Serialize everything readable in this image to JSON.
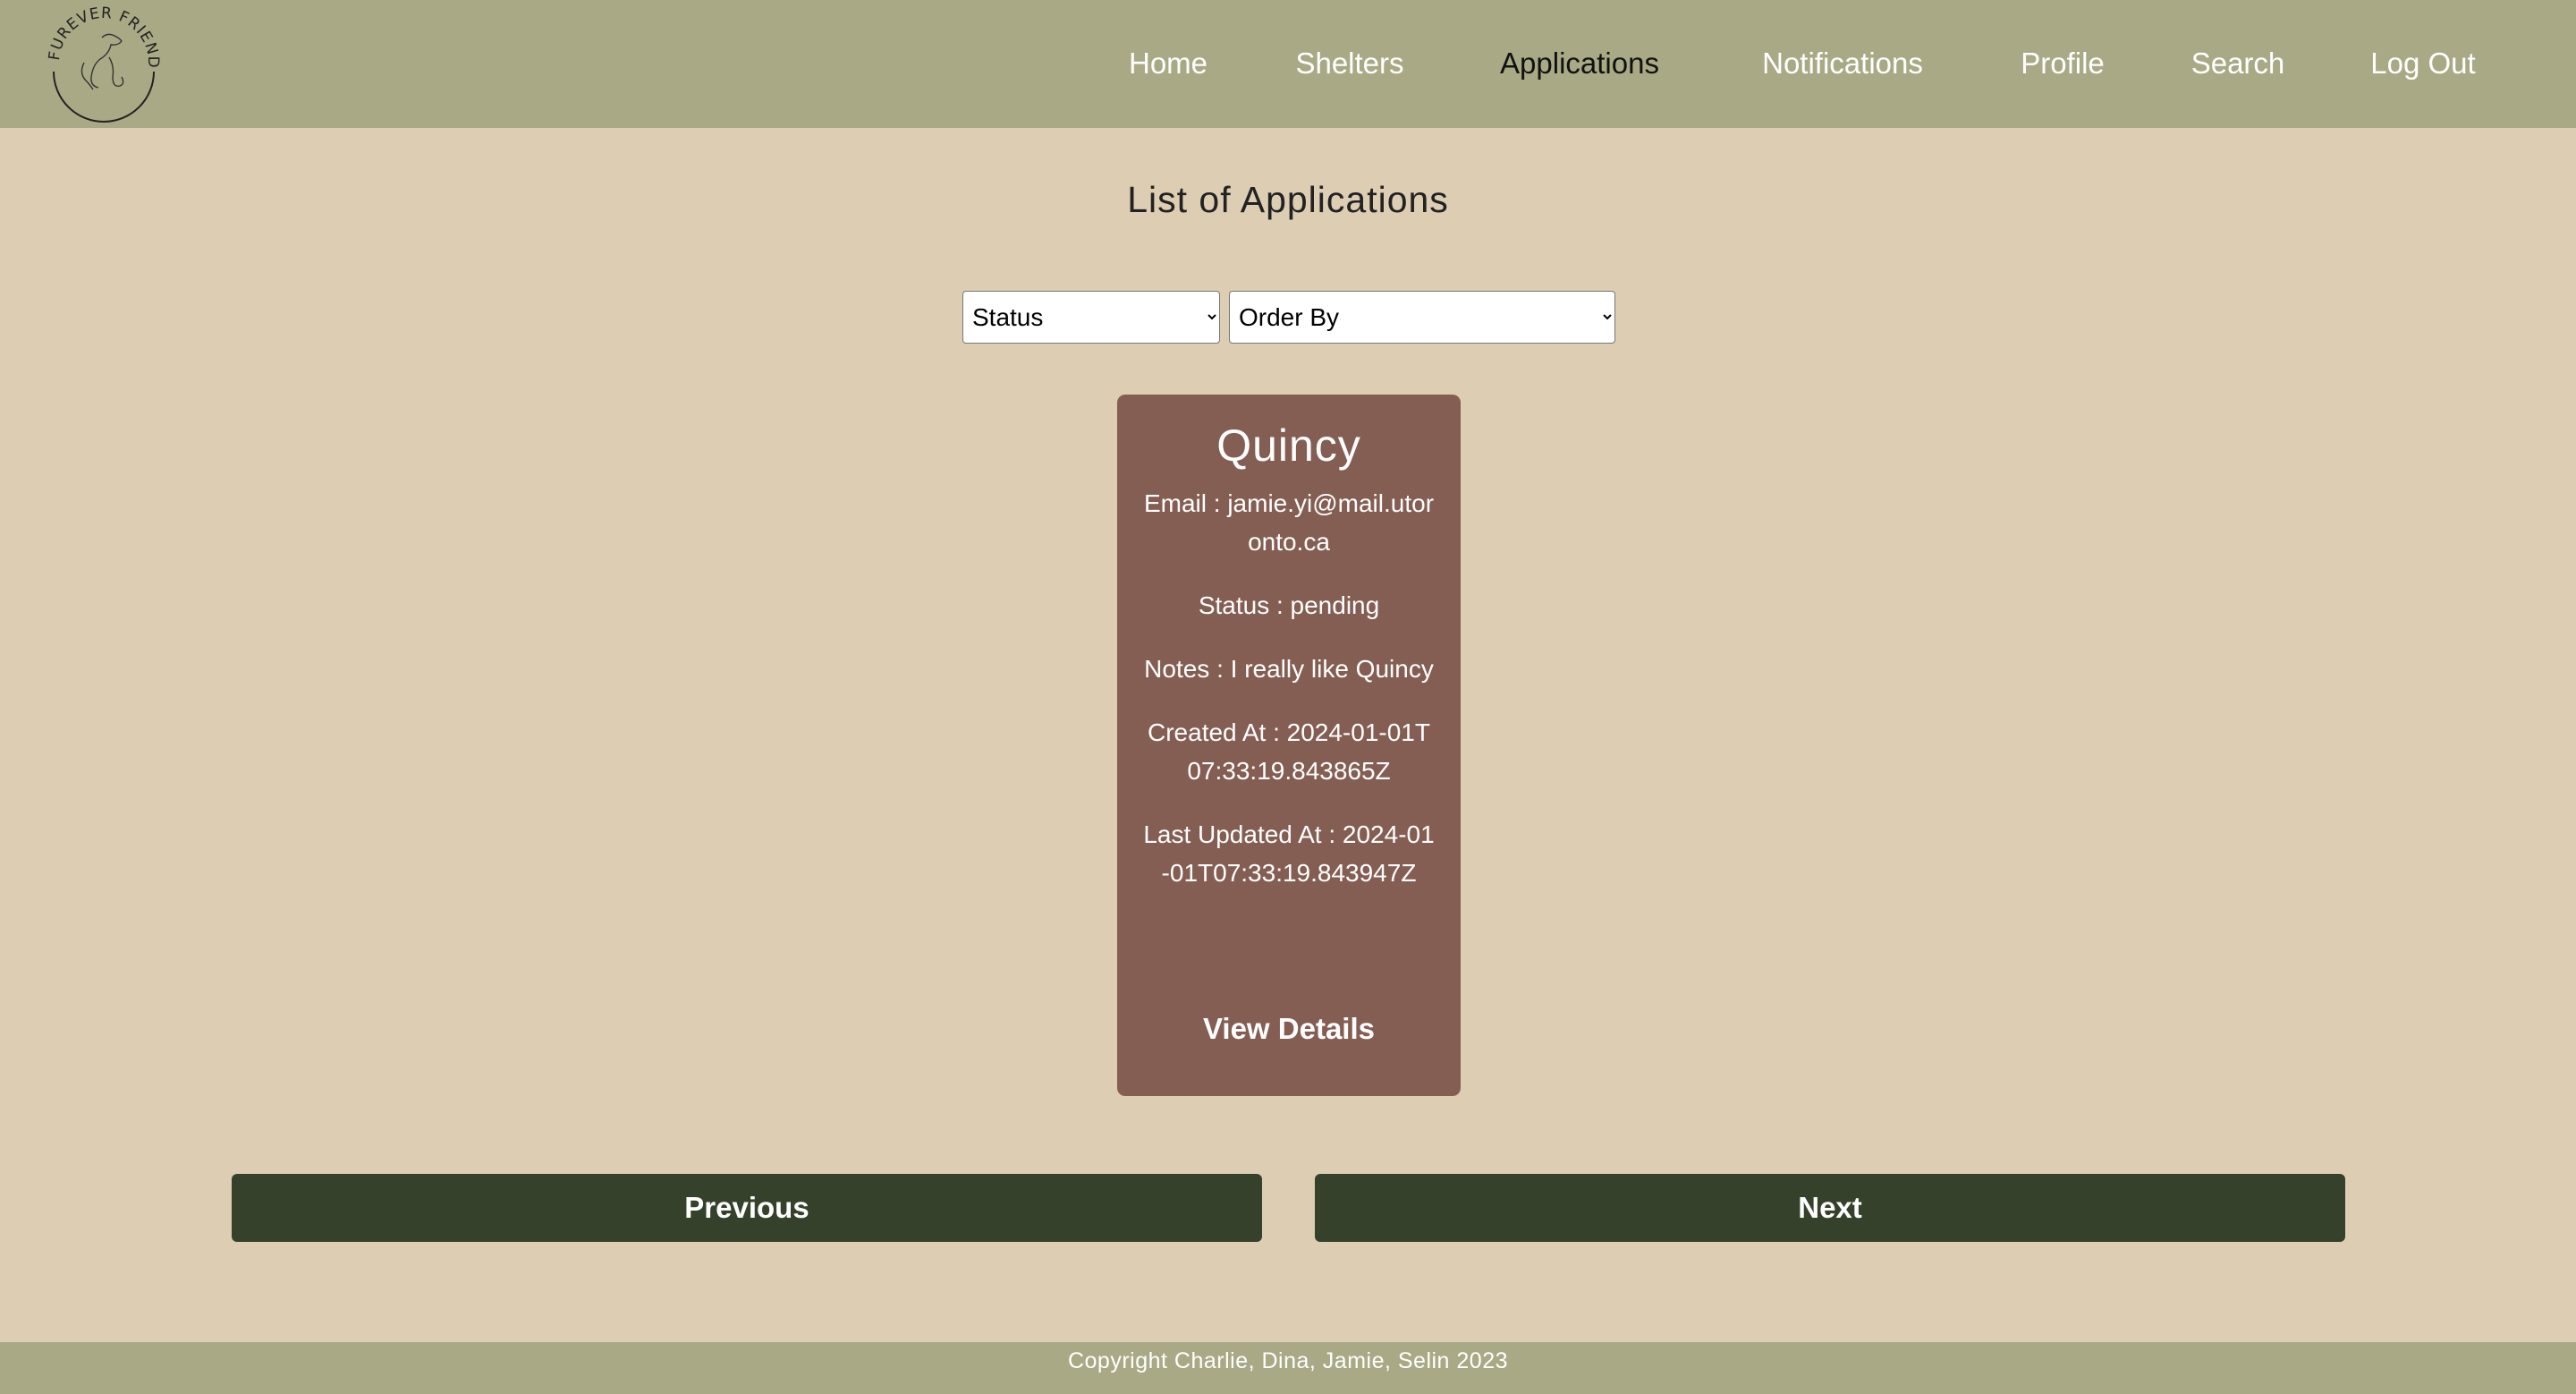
{
  "header": {
    "logo_text": "FUREVER FRIENDS",
    "nav": [
      {
        "label": "Home",
        "active": false
      },
      {
        "label": "Shelters",
        "active": false
      },
      {
        "label": "Applications",
        "active": true
      },
      {
        "label": "Notifications",
        "active": false
      },
      {
        "label": "Profile",
        "active": false
      },
      {
        "label": "Search",
        "active": false
      },
      {
        "label": "Log Out",
        "active": false
      }
    ]
  },
  "main": {
    "title": "List of Applications",
    "filters": {
      "status": "Status",
      "order_by": "Order By"
    },
    "applications": [
      {
        "pet_name": "Quincy",
        "email": "Email : jamie.yi@mail.utoronto.ca",
        "status": "Status : pending",
        "notes": "Notes : I really like Quincy",
        "created_at": "Created At : 2024-01-01T07:33:19.843865Z",
        "updated_at": "Last Updated At : 2024-01-01T07:33:19.843947Z",
        "view_label": "View Details"
      }
    ],
    "pagination": {
      "previous": "Previous",
      "next": "Next"
    }
  },
  "footer": {
    "text": "Copyright Charlie, Dina, Jamie, Selin 2023"
  },
  "colors": {
    "header": "#aaa985",
    "background": "#dccdb3",
    "card": "#845e53",
    "button": "#36412b"
  }
}
